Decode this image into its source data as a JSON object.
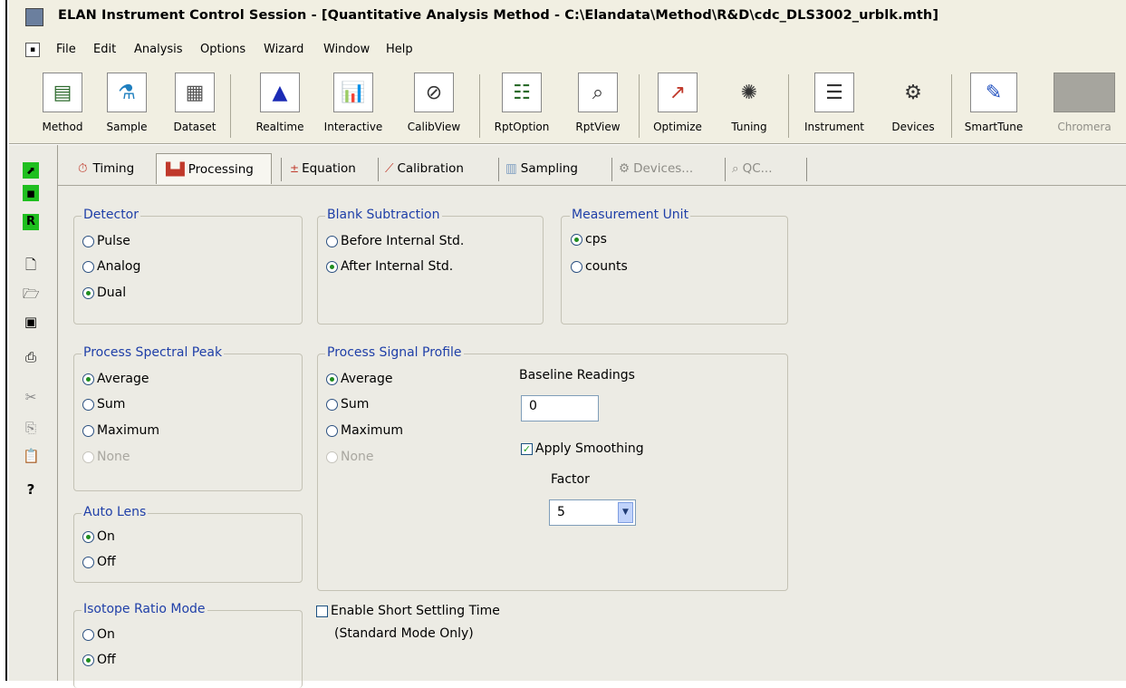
{
  "title_bar": {
    "text": "ELAN Instrument Control Session - [Quantitative Analysis Method - C:\\Elandata\\Method\\R&D\\cdc_DLS3002_urblk.mth]"
  },
  "menu": {
    "items": [
      "File",
      "Edit",
      "Analysis",
      "Options",
      "Wizard",
      "Window",
      "Help"
    ]
  },
  "toolbar": {
    "buttons": [
      {
        "label": "Method",
        "icon": "method-icon"
      },
      {
        "label": "Sample",
        "icon": "sample-icon"
      },
      {
        "label": "Dataset",
        "icon": "dataset-icon"
      },
      {
        "label": "Realtime",
        "icon": "realtime-icon"
      },
      {
        "label": "Interactive",
        "icon": "interactive-icon"
      },
      {
        "label": "CalibView",
        "icon": "calibview-icon"
      },
      {
        "label": "RptOption",
        "icon": "rptoption-icon"
      },
      {
        "label": "RptView",
        "icon": "rptview-icon"
      },
      {
        "label": "Optimize",
        "icon": "optimize-icon"
      },
      {
        "label": "Tuning",
        "icon": "tuning-icon"
      },
      {
        "label": "Instrument",
        "icon": "instrument-icon"
      },
      {
        "label": "Devices",
        "icon": "devices-icon"
      },
      {
        "label": "SmartTune",
        "icon": "smarttune-icon"
      },
      {
        "label": "Chromera",
        "icon": "chromera-icon",
        "disabled": true
      }
    ]
  },
  "sidebar": {
    "icons": [
      "open-green-icon",
      "save-green-icon",
      "r-icon",
      "new-document-icon",
      "open-folder-icon",
      "save-icon",
      "print-icon",
      "cut-icon",
      "copy-icon",
      "paste-icon",
      "help-icon"
    ]
  },
  "tabs": [
    {
      "label": "Timing",
      "icon": "timer-icon",
      "state": "normal"
    },
    {
      "label": "Processing",
      "icon": "processing-icon",
      "state": "active"
    },
    {
      "label": "Equation",
      "icon": "equation-icon",
      "state": "normal"
    },
    {
      "label": "Calibration",
      "icon": "calibration-icon",
      "state": "normal"
    },
    {
      "label": "Sampling",
      "icon": "sampling-icon",
      "state": "normal"
    },
    {
      "label": "Devices...",
      "icon": "devices-tab-icon",
      "state": "disabled"
    },
    {
      "label": "QC...",
      "icon": "qc-icon",
      "state": "disabled"
    }
  ],
  "detector": {
    "title": "Detector",
    "options": [
      "Pulse",
      "Analog",
      "Dual"
    ],
    "selected": "Dual"
  },
  "blank_subtraction": {
    "title": "Blank Subtraction",
    "options": [
      "Before Internal Std.",
      "After Internal Std."
    ],
    "selected": "After Internal Std."
  },
  "measurement_unit": {
    "title": "Measurement Unit",
    "options": [
      "cps",
      "counts"
    ],
    "selected": "cps"
  },
  "process_spectral_peak": {
    "title": "Process Spectral Peak",
    "options": [
      "Average",
      "Sum",
      "Maximum",
      "None"
    ],
    "selected": "Average",
    "disabled": [
      "None"
    ]
  },
  "process_signal_profile": {
    "title": "Process Signal Profile",
    "options": [
      "Average",
      "Sum",
      "Maximum",
      "None"
    ],
    "selected": "Average",
    "disabled": [
      "None"
    ],
    "baseline_label": "Baseline Readings",
    "baseline_value": "0",
    "smoothing_label": "Apply Smoothing",
    "smoothing_checked": true,
    "factor_label": "Factor",
    "factor_value": "5"
  },
  "auto_lens": {
    "title": "Auto Lens",
    "options": [
      "On",
      "Off"
    ],
    "selected": "On"
  },
  "isotope_ratio": {
    "title": "Isotope Ratio Mode",
    "options": [
      "On",
      "Off"
    ],
    "selected": "Off"
  },
  "short_settling": {
    "label": "Enable Short Settling Time",
    "sublabel": "(Standard Mode Only)",
    "checked": false
  }
}
